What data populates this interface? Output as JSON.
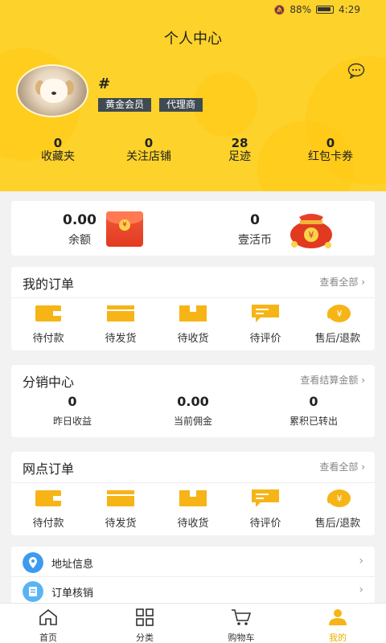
{
  "status": {
    "battery": "88%",
    "time": "4:29"
  },
  "title": "个人中心",
  "user": {
    "name": "#",
    "badges": [
      "黄金会员",
      "代理商"
    ]
  },
  "stats": [
    {
      "value": "0",
      "label": "收藏夹"
    },
    {
      "value": "0",
      "label": "关注店铺"
    },
    {
      "value": "28",
      "label": "足迹"
    },
    {
      "value": "0",
      "label": "红包卡券"
    }
  ],
  "balance": {
    "amount": "0.00",
    "amount_label": "余额",
    "coin": "0",
    "coin_label": "壹活币"
  },
  "orders": {
    "title": "我的订单",
    "more": "查看全部",
    "items": [
      "待付款",
      "待发货",
      "待收货",
      "待评价",
      "售后/退款"
    ]
  },
  "distribution": {
    "title": "分销中心",
    "more": "查看结算金额",
    "items": [
      {
        "value": "0",
        "label": "昨日收益"
      },
      {
        "value": "0.00",
        "label": "当前佣金"
      },
      {
        "value": "0",
        "label": "累积已转出"
      }
    ]
  },
  "outlet_orders": {
    "title": "网点订单",
    "more": "查看全部",
    "items": [
      "待付款",
      "待发货",
      "待收货",
      "待评价",
      "售后/退款"
    ]
  },
  "list": [
    {
      "label": "地址信息",
      "icon": "location-icon"
    },
    {
      "label": "订单核销",
      "icon": "document-icon"
    }
  ],
  "tabs": [
    {
      "label": "首页",
      "icon": "home-icon"
    },
    {
      "label": "分类",
      "icon": "grid-icon"
    },
    {
      "label": "购物车",
      "icon": "cart-icon"
    },
    {
      "label": "我的",
      "icon": "user-icon",
      "active": true
    }
  ],
  "colors": {
    "accent": "#fdd22a",
    "active_tab": "#e2b300",
    "icon_yellow": "#f6b417"
  }
}
